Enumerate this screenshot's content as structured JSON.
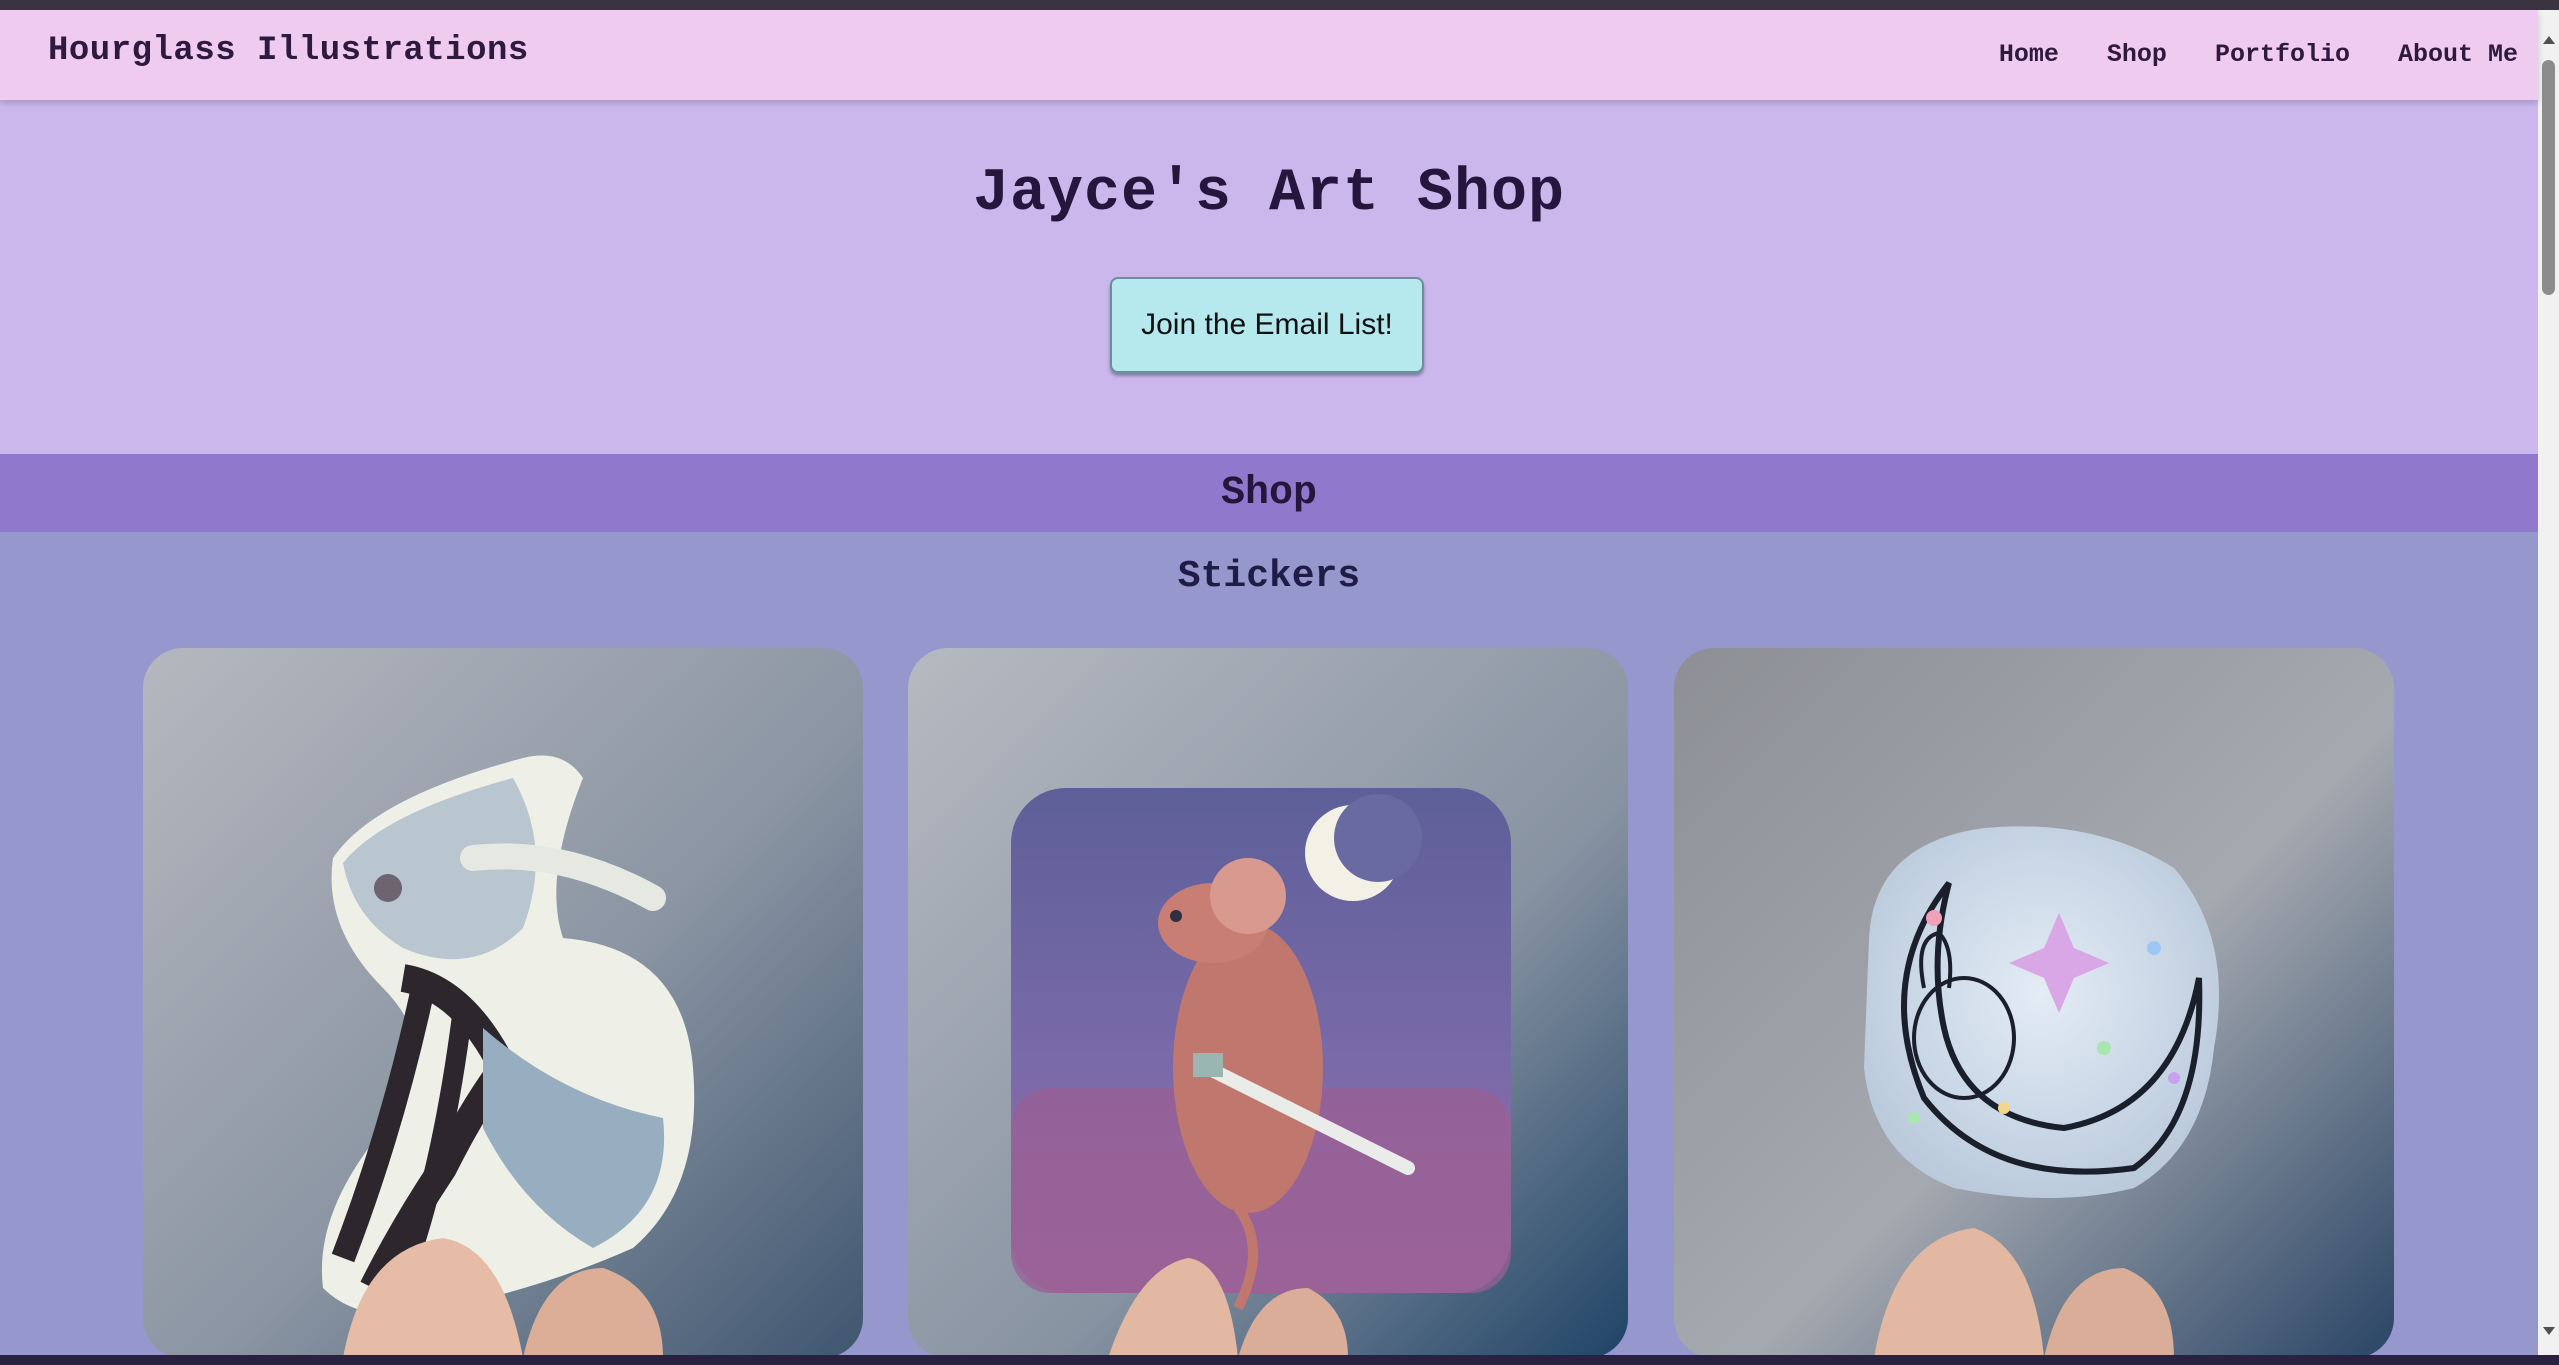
{
  "header": {
    "brand": "Hourglass Illustrations",
    "nav": [
      "Home",
      "Shop",
      "Portfolio",
      "About Me"
    ]
  },
  "hero": {
    "title": "Jayce's Art Shop",
    "cta_label": "Join the Email List!"
  },
  "shop": {
    "band_title": "Shop",
    "section_title": "Stickers",
    "products": [
      {
        "subject": "hourglass-figure-sticker"
      },
      {
        "subject": "mouse-with-sword-sticker"
      },
      {
        "subject": "holographic-bunny-on-moon-sticker"
      }
    ]
  },
  "colors": {
    "nav_bg": "#eecbef",
    "hero_bg": "#cbb7ec",
    "band_bg": "#9079cc",
    "section_bg": "#9597cd",
    "button_bg": "#b6e9ee",
    "text_dark": "#26153d"
  }
}
